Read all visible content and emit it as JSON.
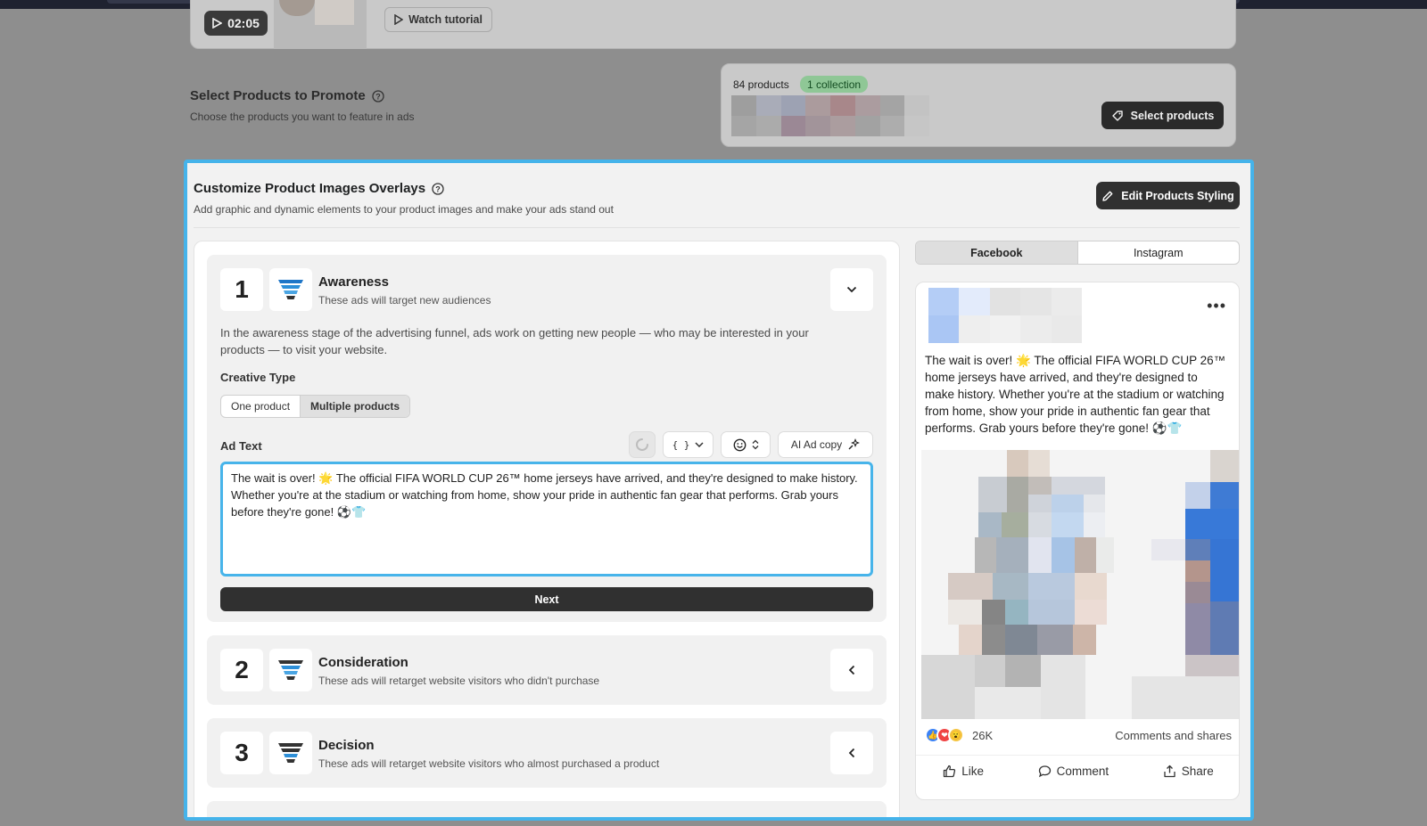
{
  "tutorial": {
    "timer": "02:05",
    "watch_label": "Watch tutorial"
  },
  "select_products": {
    "title": "Select Products to Promote",
    "subtitle": "Choose the products you want to feature in ads",
    "count": "84 products",
    "badge": "1 collection",
    "button": "Select products"
  },
  "overlays": {
    "title": "Customize Product Images Overlays",
    "subtitle": "Add graphic and dynamic elements to your product images and make your ads stand out",
    "edit_button": "Edit Products Styling"
  },
  "stages": [
    {
      "num": "1",
      "title": "Awareness",
      "subtitle": "These ads will target new audiences"
    },
    {
      "num": "2",
      "title": "Consideration",
      "subtitle": "These ads will retarget website visitors who didn't purchase"
    },
    {
      "num": "3",
      "title": "Decision",
      "subtitle": "These ads will retarget website visitors who almost purchased a product"
    }
  ],
  "awareness": {
    "description": "In the awareness stage of the advertising funnel, ads work on getting new people — who may be interested in your products — to visit your website.",
    "creative_type_label": "Creative Type",
    "creative_options": [
      "One product",
      "Multiple products"
    ],
    "selected_creative": "Multiple products",
    "ad_text_label": "Ad Text",
    "variables_label": "{ }",
    "ai_label": "AI Ad copy",
    "ad_text": "The wait is over! 🌟 The official FIFA WORLD CUP 26™ home jerseys have arrived, and they're designed to make history. Whether you're at the stadium or watching from home, show your pride in authentic fan gear that performs. Grab yours before they're gone! ⚽👕",
    "next_label": "Next"
  },
  "preview": {
    "tabs": [
      "Facebook",
      "Instagram"
    ],
    "active_tab": "Facebook",
    "post_text": "The wait is over! 🌟 The official FIFA WORLD CUP 26™ home jerseys have arrived, and they're designed to make history. Whether you're at the stadium or watching from home, show your pride in authentic fan gear that performs. Grab yours before they're gone! ⚽👕",
    "reactions_count": "26K",
    "comments_shares": "Comments and shares",
    "actions": {
      "like": "Like",
      "comment": "Comment",
      "share": "Share"
    }
  },
  "colors": {
    "accent": "#45b3ea",
    "dark_button": "#303030",
    "badge_green": "#8fc796"
  }
}
